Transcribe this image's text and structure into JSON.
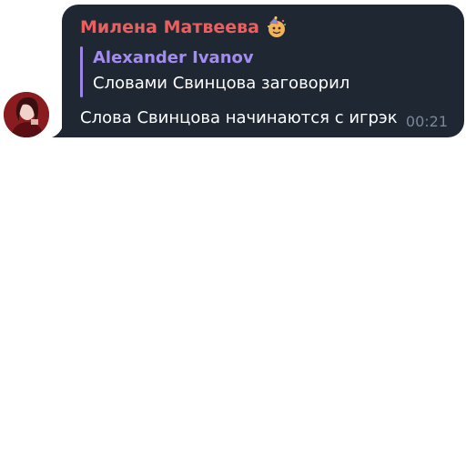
{
  "message": {
    "sender_name": "Милена Матвеева",
    "sender_status_icon": "party-emoji-icon",
    "reply": {
      "author": "Alexander Ivanov",
      "text": "Словами Свинцова заговорил"
    },
    "text": "Слова Свинцова начинаются с игрэк",
    "time": "00:21"
  },
  "colors": {
    "bubble_bg": "#1f2733",
    "sender_name": "#e8605f",
    "reply_author": "#a28cf0",
    "reply_bar": "#9d86e6",
    "message_text": "#ffffff",
    "time_text": "#7b8696"
  }
}
